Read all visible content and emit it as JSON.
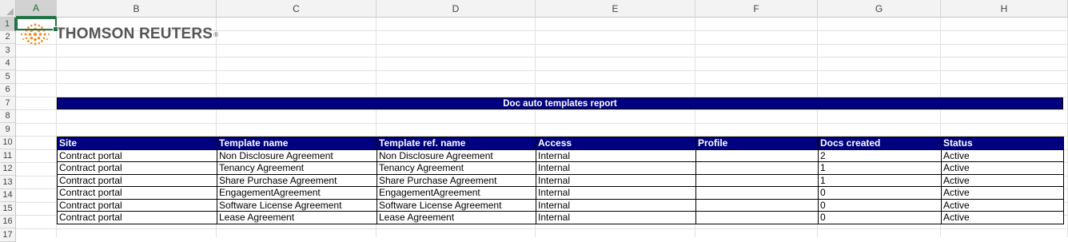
{
  "sheet": {
    "selected_cell": "A1",
    "columns": [
      "A",
      "B",
      "C",
      "D",
      "E",
      "F",
      "G",
      "H"
    ],
    "rows": [
      "1",
      "2",
      "3",
      "4",
      "5",
      "6",
      "7",
      "8",
      "9",
      "10",
      "11",
      "12",
      "13",
      "14",
      "15",
      "16",
      "17"
    ]
  },
  "logo": {
    "text": "THOMSON REUTERS",
    "reg": "®",
    "accent_color": "#f08c2a"
  },
  "report": {
    "title": "Doc auto templates report",
    "header_color": "#000080",
    "headers": [
      "Site",
      "Template name",
      "Template ref. name",
      "Access",
      "Profile",
      "Docs created",
      "Status"
    ],
    "rows": [
      [
        "Contract portal",
        "Non Disclosure Agreement",
        "Non Disclosure Agreement",
        "Internal",
        "",
        "2",
        "Active"
      ],
      [
        "Contract portal",
        "Tenancy Agreement",
        "Tenancy Agreement",
        "Internal",
        "",
        "1",
        "Active"
      ],
      [
        "Contract portal",
        "Share Purchase Agreement",
        "Share Purchase Agreement",
        "Internal",
        "",
        "1",
        "Active"
      ],
      [
        "Contract portal",
        "EngagementAgreement",
        "EngagementAgreement",
        "Internal",
        "",
        "0",
        "Active"
      ],
      [
        "Contract portal",
        "Software License Agreement",
        "Software License Agreement",
        "Internal",
        "",
        "0",
        "Active"
      ],
      [
        "Contract portal",
        "Lease Agreement",
        "Lease Agreement",
        "Internal",
        "",
        "0",
        "Active"
      ]
    ]
  }
}
